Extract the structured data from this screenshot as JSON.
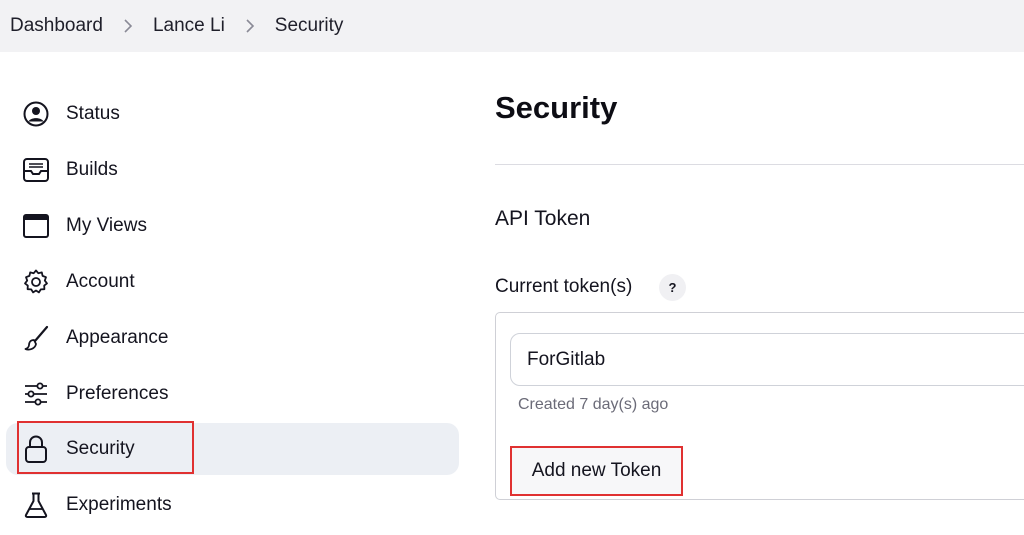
{
  "breadcrumb": {
    "items": [
      "Dashboard",
      "Lance Li",
      "Security"
    ]
  },
  "sidebar": {
    "items": [
      {
        "label": "Status",
        "icon": "user-circle-icon"
      },
      {
        "label": "Builds",
        "icon": "inbox-tray-icon"
      },
      {
        "label": "My Views",
        "icon": "window-icon"
      },
      {
        "label": "Account",
        "icon": "gear-icon"
      },
      {
        "label": "Appearance",
        "icon": "paintbrush-icon"
      },
      {
        "label": "Preferences",
        "icon": "sliders-icon"
      },
      {
        "label": "Security",
        "icon": "lock-icon",
        "active": true
      },
      {
        "label": "Experiments",
        "icon": "flask-icon"
      }
    ]
  },
  "main": {
    "title": "Security",
    "api_token": {
      "heading": "API Token",
      "current_label": "Current token(s)",
      "help_label": "?",
      "tokens": [
        {
          "name": "ForGitlab",
          "created": "Created 7 day(s) ago"
        }
      ],
      "add_button": "Add new Token"
    }
  },
  "colors": {
    "topbar_bg": "#f2f2f4",
    "active_item_bg": "#eceff4",
    "highlight_red": "#e03131"
  }
}
